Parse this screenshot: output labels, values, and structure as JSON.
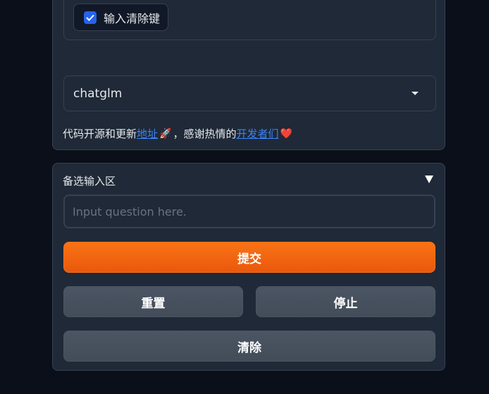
{
  "top_panel": {
    "checkbox": {
      "label": "输入清除键",
      "checked": true
    },
    "model_select": {
      "value": "chatglm"
    },
    "info": {
      "prefix": "代码开源和更新",
      "link1": "地址",
      "rocket": "🚀",
      "middle": "，感谢热情的",
      "link2": "开发者们",
      "heart": "❤️"
    }
  },
  "alt_input": {
    "title": "备选输入区",
    "placeholder": "Input question here.",
    "submit_label": "提交",
    "reset_label": "重置",
    "stop_label": "停止",
    "clear_label": "清除"
  },
  "colors": {
    "background": "#0b0f19",
    "panel": "#1f2937",
    "border": "#374151",
    "primary": "#f97316",
    "secondary": "#4b5563",
    "link": "#3b82f6",
    "checkbox": "#2563eb"
  }
}
